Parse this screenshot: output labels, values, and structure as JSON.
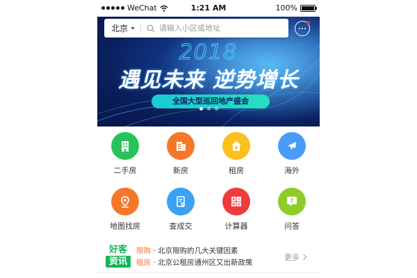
{
  "status_bar": {
    "carrier": "WeChat",
    "time": "1:21 AM",
    "battery": "100%",
    "battery_level": 1.0
  },
  "search": {
    "city": "北京",
    "placeholder": "请输入小区或地址"
  },
  "banner": {
    "year": "2018",
    "title": "遇见未来 逆势增长",
    "subtitle": "全国大型巡回地产盛会",
    "pages": 3,
    "active_page": 1
  },
  "grid": [
    {
      "label": "二手房",
      "icon": "building-icon",
      "color": "#27c35a"
    },
    {
      "label": "新房",
      "icon": "new-house-icon",
      "color": "#f5782a"
    },
    {
      "label": "租房",
      "icon": "rent-icon",
      "color": "#fbbf1e"
    },
    {
      "label": "海外",
      "icon": "airplane-icon",
      "color": "#4a9bf5"
    },
    {
      "label": "地图找房",
      "icon": "map-pin-icon",
      "color": "#f5782a"
    },
    {
      "label": "查成交",
      "icon": "document-check-icon",
      "color": "#3aa2f0"
    },
    {
      "label": "计算器",
      "icon": "calculator-icon",
      "color": "#ef3b3b"
    },
    {
      "label": "问答",
      "icon": "question-icon",
      "color": "#8fcc2a"
    }
  ],
  "news": {
    "logo_line1": "好客",
    "logo_line2": "资讯",
    "items": [
      {
        "tag": "限购",
        "text": "北京限购的几大关键因素"
      },
      {
        "tag": "租房",
        "text": "北京公租房通州区又出新政策"
      }
    ],
    "more": "更多"
  }
}
